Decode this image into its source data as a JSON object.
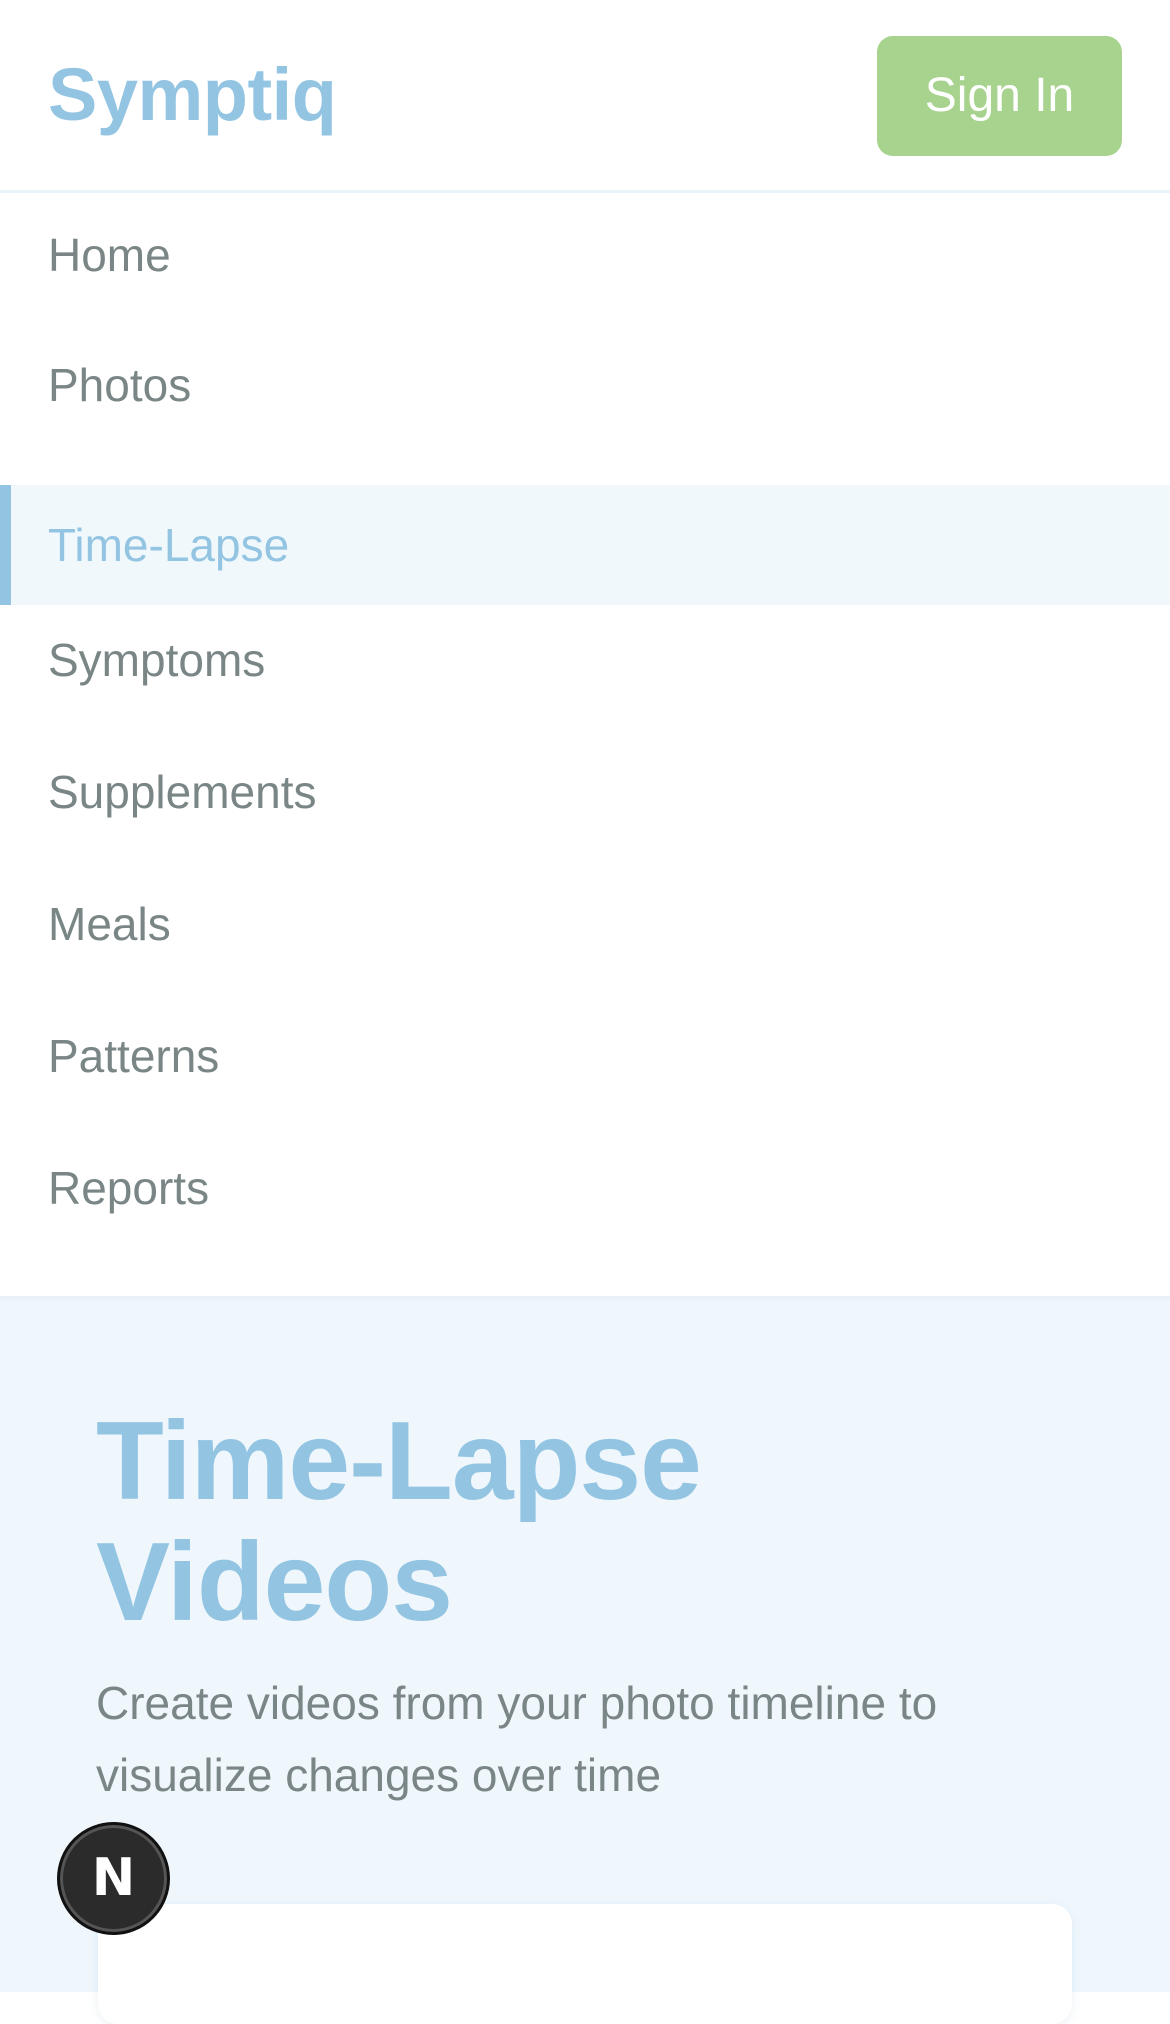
{
  "header": {
    "logo": "Symptiq",
    "sign_in_label": "Sign In"
  },
  "nav": {
    "items": [
      {
        "label": "Home",
        "active": false
      },
      {
        "label": "Photos",
        "active": false
      },
      {
        "label": "Time-Lapse",
        "active": true
      },
      {
        "label": "Symptoms",
        "active": false
      },
      {
        "label": "Supplements",
        "active": false
      },
      {
        "label": "Meals",
        "active": false
      },
      {
        "label": "Patterns",
        "active": false
      },
      {
        "label": "Reports",
        "active": false
      }
    ]
  },
  "hero": {
    "title_line1": "Time-Lapse",
    "title_line2": "Videos",
    "subtitle": "Create videos from your photo timeline to visualize changes over time"
  },
  "fab": {
    "glyph": "N",
    "icon": "next-logo-icon"
  },
  "colors": {
    "accent": "#93c5e3",
    "sign_in_bg": "#a8d38e",
    "text_muted": "#7a8686",
    "hero_bg": "#eff7fd"
  }
}
